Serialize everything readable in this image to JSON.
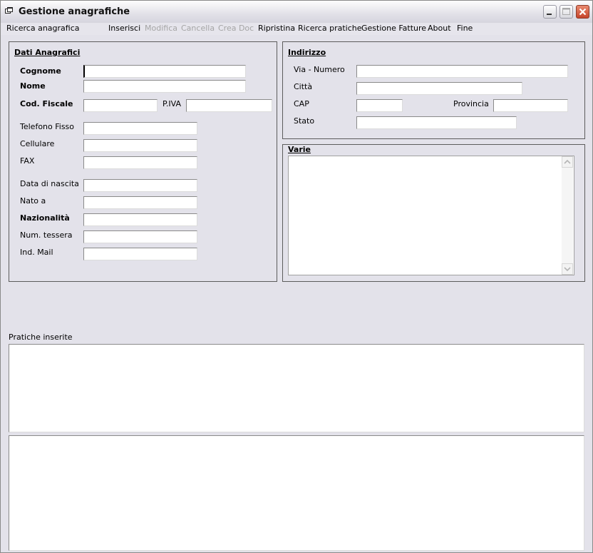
{
  "window": {
    "title": "Gestione anagrafiche"
  },
  "menu": {
    "items": [
      {
        "label": "Ricerca anagrafica",
        "enabled": true
      },
      {
        "label": "Inserisci",
        "enabled": true
      },
      {
        "label": "Modifica",
        "enabled": false
      },
      {
        "label": "Cancella",
        "enabled": false
      },
      {
        "label": "Crea Doc",
        "enabled": false
      },
      {
        "label": "Ripristina",
        "enabled": true
      },
      {
        "label": "Ricerca pratiche",
        "enabled": true
      },
      {
        "label": "Gestione Fatture",
        "enabled": true
      },
      {
        "label": "About",
        "enabled": true
      },
      {
        "label": "Fine",
        "enabled": true
      }
    ]
  },
  "dati_anagrafici": {
    "title": "Dati Anagrafici",
    "cognome": "Cognome",
    "nome": "Nome",
    "cod_fiscale": "Cod. Fiscale",
    "piva": "P.IVA",
    "telefono_fisso": "Telefono Fisso",
    "cellulare": "Cellulare",
    "fax": "FAX",
    "data_nascita": "Data di nascita",
    "nato_a": "Nato a",
    "nazionalita": "Nazionalità",
    "num_tessera": "Num. tessera",
    "ind_mail": "Ind. Mail"
  },
  "indirizzo": {
    "title": "Indirizzo",
    "via_numero": "Via - Numero",
    "citta": "Città",
    "cap": "CAP",
    "provincia": "Provincia",
    "stato": "Stato"
  },
  "varie": {
    "title": "Varie"
  },
  "pratiche": {
    "label": "Pratiche inserite"
  },
  "icons": {
    "app": "window-restore-icon",
    "minimize": "minimize-icon",
    "maximize": "maximize-icon",
    "close": "close-icon"
  },
  "colors": {
    "close_button": "#c5432a",
    "field_border": "#7f9db9"
  }
}
